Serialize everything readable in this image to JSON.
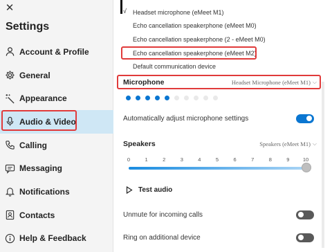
{
  "sidebar": {
    "title": "Settings",
    "close_icon": "close-icon",
    "items": [
      {
        "label": "Account & Profile",
        "icon": "person-icon"
      },
      {
        "label": "General",
        "icon": "gear-icon"
      },
      {
        "label": "Appearance",
        "icon": "wand-icon"
      },
      {
        "label": "Audio & Video",
        "icon": "microphone-icon",
        "active": true
      },
      {
        "label": "Calling",
        "icon": "phone-icon"
      },
      {
        "label": "Messaging",
        "icon": "message-icon"
      },
      {
        "label": "Notifications",
        "icon": "bell-icon"
      },
      {
        "label": "Contacts",
        "icon": "contacts-icon"
      },
      {
        "label": "Help & Feedback",
        "icon": "info-icon"
      }
    ]
  },
  "dropdown": {
    "options": [
      {
        "label": "Headset microphone (eMeet M1)",
        "checked": true
      },
      {
        "label": "Echo cancellation speakerphone (eMeet M0)"
      },
      {
        "label": "Echo cancellation speakerphone (2 - eMeet M0)"
      },
      {
        "label": "Echo cancellation speakerphone (eMeet M2)",
        "highlighted": true
      },
      {
        "label": "Default communication device"
      }
    ],
    "check_mark": "√"
  },
  "microphone": {
    "label": "Microphone",
    "device": "Headset Microphone (eMeet M1)",
    "level_dots_active": 5,
    "level_dots_total": 10
  },
  "auto_adjust": {
    "label": "Automatically adjust microphone settings",
    "on": true
  },
  "speakers": {
    "label": "Speakers",
    "device": "Speakers (eMeet M1)",
    "scale": [
      "0",
      "1",
      "2",
      "3",
      "4",
      "5",
      "6",
      "7",
      "8",
      "9",
      "10"
    ],
    "volume": 10
  },
  "test_audio": {
    "label": "Test audio"
  },
  "unmute_incoming": {
    "label": "Unmute for incoming calls",
    "on": false
  },
  "ring_additional": {
    "label": "Ring on additional device",
    "on": false
  },
  "colors": {
    "accent": "#0a76d1",
    "highlight_box": "#e03a3a",
    "active_nav": "#cfe7f5"
  }
}
